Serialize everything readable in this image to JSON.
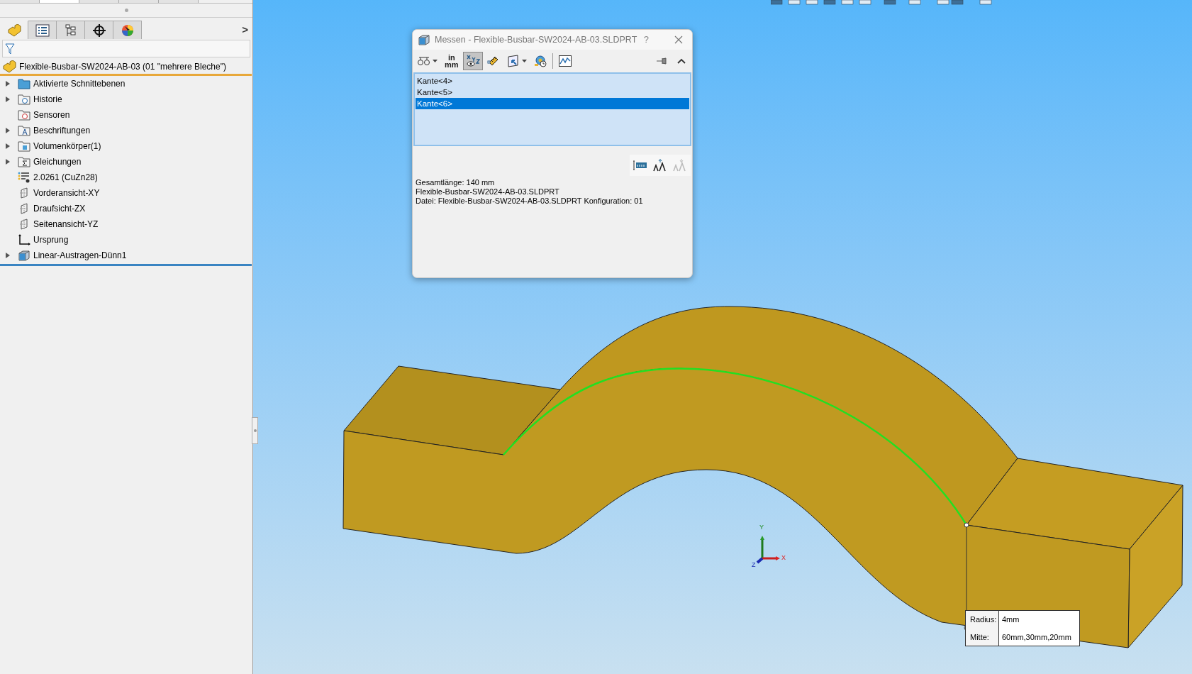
{
  "feature_tree": {
    "top_tabs": [
      {
        "selected": false
      },
      {
        "selected": true
      },
      {
        "selected": false
      },
      {
        "selected": false
      },
      {
        "selected": false
      }
    ],
    "tabs": [
      {
        "kind": "part",
        "selected": true
      },
      {
        "kind": "properties",
        "selected": false
      },
      {
        "kind": "configurations",
        "selected": false
      },
      {
        "kind": "crosshair",
        "selected": false
      },
      {
        "kind": "appearance",
        "selected": false
      }
    ],
    "more": ">",
    "root": "Flexible-Busbar-SW2024-AB-03 (01 \"mehrere Bleche\")",
    "items": [
      {
        "label": "Aktivierte Schnittebenen",
        "kind": "folder",
        "expandable": true
      },
      {
        "label": "Historie",
        "kind": "history",
        "expandable": true
      },
      {
        "label": "Sensoren",
        "kind": "sensor",
        "expandable": false
      },
      {
        "label": "Beschriftungen",
        "kind": "annotation",
        "expandable": true
      },
      {
        "label": "Volumenkörper(1)",
        "kind": "solid",
        "expandable": true
      },
      {
        "label": "Gleichungen",
        "kind": "equation",
        "expandable": true
      },
      {
        "label": "2.0261 (CuZn28)",
        "kind": "material",
        "expandable": false
      },
      {
        "label": "Vorderansicht-XY",
        "kind": "plane",
        "expandable": false
      },
      {
        "label": "Draufsicht-ZX",
        "kind": "plane",
        "expandable": false
      },
      {
        "label": "Seitenansicht-YZ",
        "kind": "plane",
        "expandable": false
      },
      {
        "label": "Ursprung",
        "kind": "origin",
        "expandable": false
      },
      {
        "label": "Linear-Austragen-Dünn1",
        "kind": "feature",
        "expandable": true
      }
    ]
  },
  "measure_dialog": {
    "title": "Messen - Flexible-Busbar-SW2024-AB-03.SLDPRT",
    "help": "?",
    "toolbar": [
      {
        "kind": "arc",
        "pressed": false,
        "dropdown": true
      },
      {
        "kind": "units",
        "pressed": false,
        "dropdown": false,
        "top": "in",
        "bottom": "mm"
      },
      {
        "kind": "xyz",
        "pressed": true,
        "dropdown": false
      },
      {
        "kind": "ruler",
        "pressed": false,
        "dropdown": false
      },
      {
        "kind": "projection",
        "pressed": false,
        "dropdown": true
      },
      {
        "kind": "history",
        "pressed": false,
        "dropdown": false
      },
      {
        "kind": "graph",
        "pressed": false,
        "dropdown": false
      }
    ],
    "selections": [
      {
        "label": "Kante<4>",
        "selected": false
      },
      {
        "label": "Kante<5>",
        "selected": false
      },
      {
        "label": "Kante<6>",
        "selected": true
      }
    ],
    "results": [
      "Gesamtlänge: 140 mm",
      "Flexible-Busbar-SW2024-AB-03.SLDPRT",
      "Datei: Flexible-Busbar-SW2024-AB-03.SLDPRT Konfiguration: 01"
    ]
  },
  "callout": [
    {
      "label": "Radius:",
      "value": "4mm"
    },
    {
      "label": "Mitte:",
      "value": "60mm,30mm,20mm"
    }
  ],
  "triad": {
    "x": "X",
    "y": "Y",
    "z": "Z"
  }
}
